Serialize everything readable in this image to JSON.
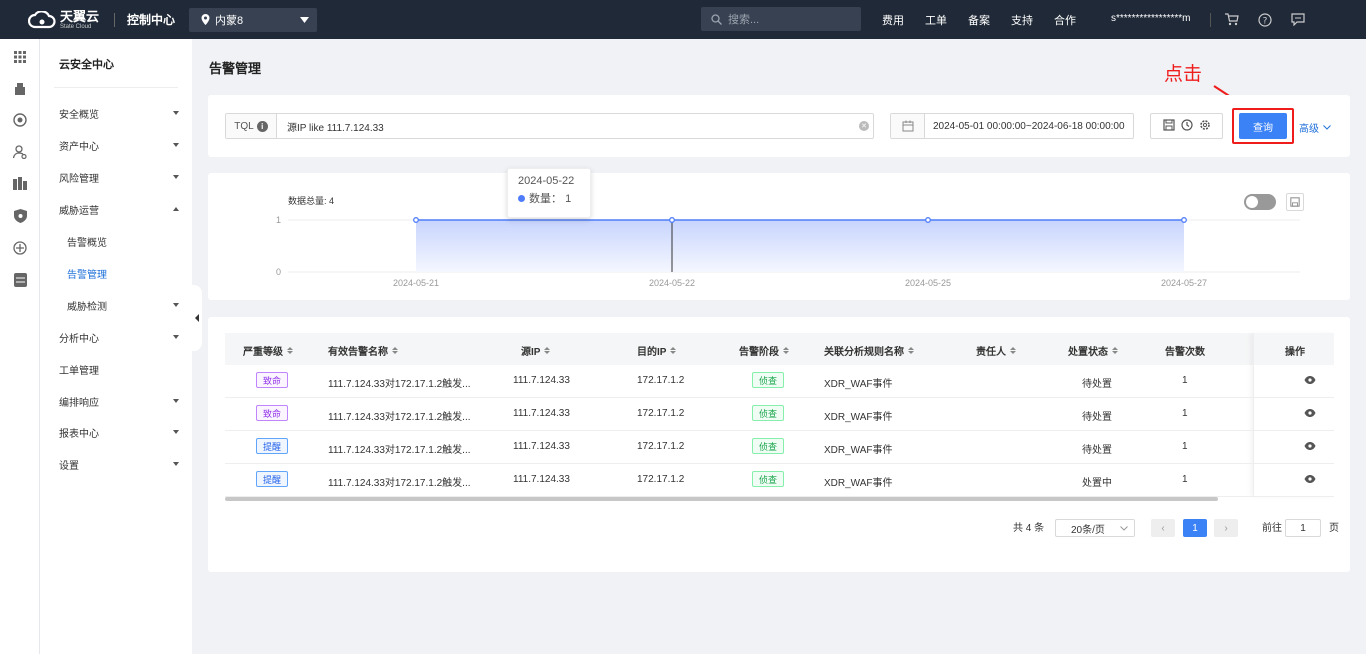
{
  "topbar": {
    "logo_cn": "天翼云",
    "logo_en": "State Cloud",
    "console": "控制中心",
    "region": "内蒙8",
    "search_placeholder": "搜索...",
    "links": [
      "费用",
      "工单",
      "备案",
      "支持",
      "合作"
    ],
    "user": "s*****************m"
  },
  "menu": {
    "title": "云安全中心",
    "items": [
      {
        "label": "安全概览",
        "caret": "down"
      },
      {
        "label": "资产中心",
        "caret": "down"
      },
      {
        "label": "风险管理",
        "caret": "down"
      },
      {
        "label": "威胁运营",
        "caret": "up"
      },
      {
        "label": "告警概览",
        "caret": ""
      },
      {
        "label": "告警管理",
        "caret": ""
      },
      {
        "label": "威胁检测",
        "caret": "down"
      },
      {
        "label": "分析中心",
        "caret": "down"
      },
      {
        "label": "工单管理",
        "caret": ""
      },
      {
        "label": "编排响应",
        "caret": "down"
      },
      {
        "label": "报表中心",
        "caret": "down"
      },
      {
        "label": "设置",
        "caret": "down"
      }
    ]
  },
  "page": {
    "title": "告警管理"
  },
  "query": {
    "tql_label": "TQL",
    "tql_value": "源IP like 111.7.124.33",
    "date_range": "2024-05-01 00:00:00~2024-06-18 00:00:00",
    "query_button": "查询",
    "advanced": "高级",
    "annotation": "点击"
  },
  "chart_data": {
    "type": "area",
    "title": "",
    "total_label": "数据总量: 4",
    "x": [
      "2024-05-21",
      "2024-05-22",
      "2024-05-25",
      "2024-05-27"
    ],
    "series": [
      {
        "name": "数量",
        "values": [
          1,
          1,
          1,
          1
        ]
      }
    ],
    "y_ticks": [
      0,
      1
    ],
    "ylim": [
      0,
      1
    ],
    "tooltip": {
      "date": "2024-05-22",
      "label": "数量：",
      "value": "1"
    },
    "colors": {
      "line": "#4f7df9"
    }
  },
  "table": {
    "headers": [
      "严重等级",
      "有效告警名称",
      "源IP",
      "目的IP",
      "告警阶段",
      "关联分析规则名称",
      "责任人",
      "处置状态",
      "告警次数",
      "操作"
    ],
    "rows": [
      {
        "severity": "致命",
        "severity_type": "fatal",
        "name": "111.7.124.33对172.17.1.2触发...",
        "src": "111.7.124.33",
        "dst": "172.17.1.2",
        "stage": "侦查",
        "rule": "XDR_WAF事件",
        "owner": "",
        "status": "待处置",
        "count": "1"
      },
      {
        "severity": "致命",
        "severity_type": "fatal",
        "name": "111.7.124.33对172.17.1.2触发...",
        "src": "111.7.124.33",
        "dst": "172.17.1.2",
        "stage": "侦查",
        "rule": "XDR_WAF事件",
        "owner": "",
        "status": "待处置",
        "count": "1"
      },
      {
        "severity": "提醒",
        "severity_type": "remind",
        "name": "111.7.124.33对172.17.1.2触发...",
        "src": "111.7.124.33",
        "dst": "172.17.1.2",
        "stage": "侦查",
        "rule": "XDR_WAF事件",
        "owner": "",
        "status": "待处置",
        "count": "1"
      },
      {
        "severity": "提醒",
        "severity_type": "remind",
        "name": "111.7.124.33对172.17.1.2触发...",
        "src": "111.7.124.33",
        "dst": "172.17.1.2",
        "stage": "侦查",
        "rule": "XDR_WAF事件",
        "owner": "",
        "status": "处置中",
        "count": "1"
      }
    ]
  },
  "pagination": {
    "total": "共 4 条",
    "page_size": "20条/页",
    "current": "1",
    "goto_label": "前往",
    "goto_value": "1",
    "page_unit": "页"
  }
}
